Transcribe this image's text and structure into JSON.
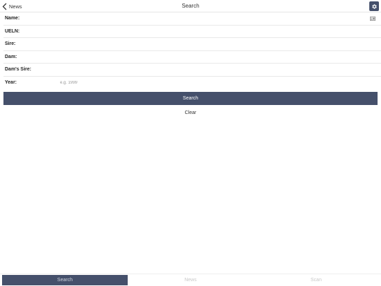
{
  "navbar": {
    "back_label": "News",
    "title": "Search",
    "settings_icon": "gear-icon"
  },
  "form": {
    "fields": [
      {
        "label": "Name:",
        "placeholder": "",
        "value": ""
      },
      {
        "label": "UELN:",
        "placeholder": "",
        "value": ""
      },
      {
        "label": "Sire:",
        "placeholder": "",
        "value": ""
      },
      {
        "label": "Dam:",
        "placeholder": "",
        "value": ""
      },
      {
        "label": "Dam's Sire:",
        "placeholder": "",
        "value": ""
      },
      {
        "label": "Year:",
        "placeholder": "e.g. 1999",
        "value": ""
      }
    ],
    "name_field_icon": "card-icon"
  },
  "actions": {
    "search_label": "Search",
    "clear_label": "Clear"
  },
  "tabbar": {
    "tabs": [
      {
        "label": "Search",
        "active": true
      },
      {
        "label": "News",
        "active": false
      },
      {
        "label": "Scan",
        "active": false
      }
    ]
  },
  "colors": {
    "accent": "#45506b",
    "divider": "#e8e8e8",
    "inactive_tab": "#c8c8c8"
  }
}
